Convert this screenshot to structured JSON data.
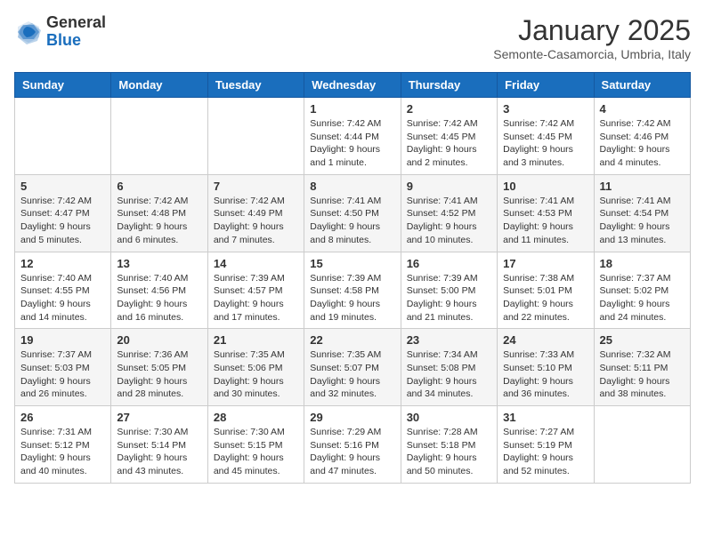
{
  "logo": {
    "general": "General",
    "blue": "Blue"
  },
  "header": {
    "month_title": "January 2025",
    "subtitle": "Semonte-Casamorcia, Umbria, Italy"
  },
  "weekdays": [
    "Sunday",
    "Monday",
    "Tuesday",
    "Wednesday",
    "Thursday",
    "Friday",
    "Saturday"
  ],
  "weeks": [
    [
      {
        "day": "",
        "info": ""
      },
      {
        "day": "",
        "info": ""
      },
      {
        "day": "",
        "info": ""
      },
      {
        "day": "1",
        "info": "Sunrise: 7:42 AM\nSunset: 4:44 PM\nDaylight: 9 hours and 1 minute."
      },
      {
        "day": "2",
        "info": "Sunrise: 7:42 AM\nSunset: 4:45 PM\nDaylight: 9 hours and 2 minutes."
      },
      {
        "day": "3",
        "info": "Sunrise: 7:42 AM\nSunset: 4:45 PM\nDaylight: 9 hours and 3 minutes."
      },
      {
        "day": "4",
        "info": "Sunrise: 7:42 AM\nSunset: 4:46 PM\nDaylight: 9 hours and 4 minutes."
      }
    ],
    [
      {
        "day": "5",
        "info": "Sunrise: 7:42 AM\nSunset: 4:47 PM\nDaylight: 9 hours and 5 minutes."
      },
      {
        "day": "6",
        "info": "Sunrise: 7:42 AM\nSunset: 4:48 PM\nDaylight: 9 hours and 6 minutes."
      },
      {
        "day": "7",
        "info": "Sunrise: 7:42 AM\nSunset: 4:49 PM\nDaylight: 9 hours and 7 minutes."
      },
      {
        "day": "8",
        "info": "Sunrise: 7:41 AM\nSunset: 4:50 PM\nDaylight: 9 hours and 8 minutes."
      },
      {
        "day": "9",
        "info": "Sunrise: 7:41 AM\nSunset: 4:52 PM\nDaylight: 9 hours and 10 minutes."
      },
      {
        "day": "10",
        "info": "Sunrise: 7:41 AM\nSunset: 4:53 PM\nDaylight: 9 hours and 11 minutes."
      },
      {
        "day": "11",
        "info": "Sunrise: 7:41 AM\nSunset: 4:54 PM\nDaylight: 9 hours and 13 minutes."
      }
    ],
    [
      {
        "day": "12",
        "info": "Sunrise: 7:40 AM\nSunset: 4:55 PM\nDaylight: 9 hours and 14 minutes."
      },
      {
        "day": "13",
        "info": "Sunrise: 7:40 AM\nSunset: 4:56 PM\nDaylight: 9 hours and 16 minutes."
      },
      {
        "day": "14",
        "info": "Sunrise: 7:39 AM\nSunset: 4:57 PM\nDaylight: 9 hours and 17 minutes."
      },
      {
        "day": "15",
        "info": "Sunrise: 7:39 AM\nSunset: 4:58 PM\nDaylight: 9 hours and 19 minutes."
      },
      {
        "day": "16",
        "info": "Sunrise: 7:39 AM\nSunset: 5:00 PM\nDaylight: 9 hours and 21 minutes."
      },
      {
        "day": "17",
        "info": "Sunrise: 7:38 AM\nSunset: 5:01 PM\nDaylight: 9 hours and 22 minutes."
      },
      {
        "day": "18",
        "info": "Sunrise: 7:37 AM\nSunset: 5:02 PM\nDaylight: 9 hours and 24 minutes."
      }
    ],
    [
      {
        "day": "19",
        "info": "Sunrise: 7:37 AM\nSunset: 5:03 PM\nDaylight: 9 hours and 26 minutes."
      },
      {
        "day": "20",
        "info": "Sunrise: 7:36 AM\nSunset: 5:05 PM\nDaylight: 9 hours and 28 minutes."
      },
      {
        "day": "21",
        "info": "Sunrise: 7:35 AM\nSunset: 5:06 PM\nDaylight: 9 hours and 30 minutes."
      },
      {
        "day": "22",
        "info": "Sunrise: 7:35 AM\nSunset: 5:07 PM\nDaylight: 9 hours and 32 minutes."
      },
      {
        "day": "23",
        "info": "Sunrise: 7:34 AM\nSunset: 5:08 PM\nDaylight: 9 hours and 34 minutes."
      },
      {
        "day": "24",
        "info": "Sunrise: 7:33 AM\nSunset: 5:10 PM\nDaylight: 9 hours and 36 minutes."
      },
      {
        "day": "25",
        "info": "Sunrise: 7:32 AM\nSunset: 5:11 PM\nDaylight: 9 hours and 38 minutes."
      }
    ],
    [
      {
        "day": "26",
        "info": "Sunrise: 7:31 AM\nSunset: 5:12 PM\nDaylight: 9 hours and 40 minutes."
      },
      {
        "day": "27",
        "info": "Sunrise: 7:30 AM\nSunset: 5:14 PM\nDaylight: 9 hours and 43 minutes."
      },
      {
        "day": "28",
        "info": "Sunrise: 7:30 AM\nSunset: 5:15 PM\nDaylight: 9 hours and 45 minutes."
      },
      {
        "day": "29",
        "info": "Sunrise: 7:29 AM\nSunset: 5:16 PM\nDaylight: 9 hours and 47 minutes."
      },
      {
        "day": "30",
        "info": "Sunrise: 7:28 AM\nSunset: 5:18 PM\nDaylight: 9 hours and 50 minutes."
      },
      {
        "day": "31",
        "info": "Sunrise: 7:27 AM\nSunset: 5:19 PM\nDaylight: 9 hours and 52 minutes."
      },
      {
        "day": "",
        "info": ""
      }
    ]
  ]
}
